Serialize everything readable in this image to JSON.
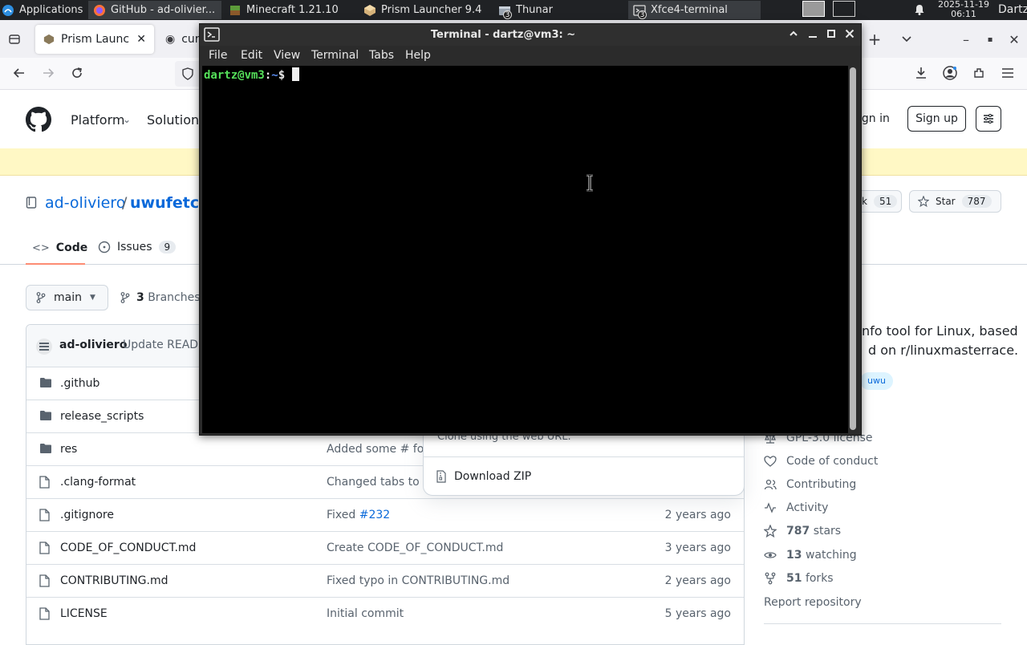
{
  "panel": {
    "apps_label": "Applications",
    "tasks": [
      {
        "label": "GitHub - ad-olivier..."
      },
      {
        "label": "Minecraft 1.21.10"
      },
      {
        "label": "Prism Launcher 9.4"
      },
      {
        "label": "Thunar",
        "badge": "3"
      },
      {
        "label": "Xfce4-terminal",
        "badge": "3"
      }
    ],
    "date": "2025-11-19",
    "time": "06:11",
    "user": "Dartz"
  },
  "firefox": {
    "tabs": [
      {
        "label": "Prism Launch"
      },
      {
        "label": "curl"
      }
    ]
  },
  "github": {
    "nav": {
      "platform": "Platform",
      "solutions": "Solutions",
      "sign_in": "ign in",
      "sign_up": "Sign up"
    },
    "repo": {
      "owner": "ad-oliviero",
      "sep": "/",
      "name": "uwufetch",
      "fork_label": "k",
      "fork_count": "51",
      "star_label": "Star",
      "star_count": "787"
    },
    "tabs": {
      "code": "Code",
      "issues": "Issues",
      "issues_count": "9"
    },
    "branch": {
      "name": "main",
      "branches_count": "3",
      "branches_label": "Branches"
    },
    "commit": {
      "author": "ad-oliviero",
      "message": "Update READM"
    },
    "files": [
      {
        "type": "folder",
        "name": ".github",
        "msg": "",
        "age": ""
      },
      {
        "type": "folder",
        "name": "release_scripts",
        "msg": "",
        "age": ""
      },
      {
        "type": "folder",
        "name": "res",
        "msg": "Added some # for b",
        "age": ""
      },
      {
        "type": "file",
        "name": ".clang-format",
        "msg": "Changed tabs to sp",
        "age": ""
      },
      {
        "type": "file",
        "name": ".gitignore",
        "msg": "Fixed ",
        "link": "#232",
        "age": "2 years ago"
      },
      {
        "type": "file",
        "name": "CODE_OF_CONDUCT.md",
        "msg": "Create CODE_OF_CONDUCT.md",
        "age": "3 years ago"
      },
      {
        "type": "file",
        "name": "CONTRIBUTING.md",
        "msg": "Fixed typo in CONTRIBUTING.md",
        "age": "2 years ago"
      },
      {
        "type": "file",
        "name": "LICENSE",
        "msg": "Initial commit",
        "age": "5 years ago"
      }
    ],
    "clone_popup": {
      "hint": "Clone using the web URL.",
      "download": "Download ZIP"
    },
    "about": {
      "line1": "nfo tool for Linux, based",
      "line2": "d on r/linuxmasterrace.",
      "topic": "uwu",
      "license": "GPL-3.0 license",
      "conduct": "Code of conduct",
      "contributing": "Contributing",
      "activity": "Activity",
      "stars_n": "787",
      "stars": "stars",
      "watching_n": "13",
      "watching": "watching",
      "forks_n": "51",
      "forks": "forks",
      "report": "Report repository"
    }
  },
  "terminal": {
    "title": "Terminal - dartz@vm3: ~",
    "menu": [
      "File",
      "Edit",
      "View",
      "Terminal",
      "Tabs",
      "Help"
    ],
    "prompt_user": "dartz@vm3",
    "prompt_colon": ":",
    "prompt_path": "~",
    "prompt_dollar": "$"
  }
}
